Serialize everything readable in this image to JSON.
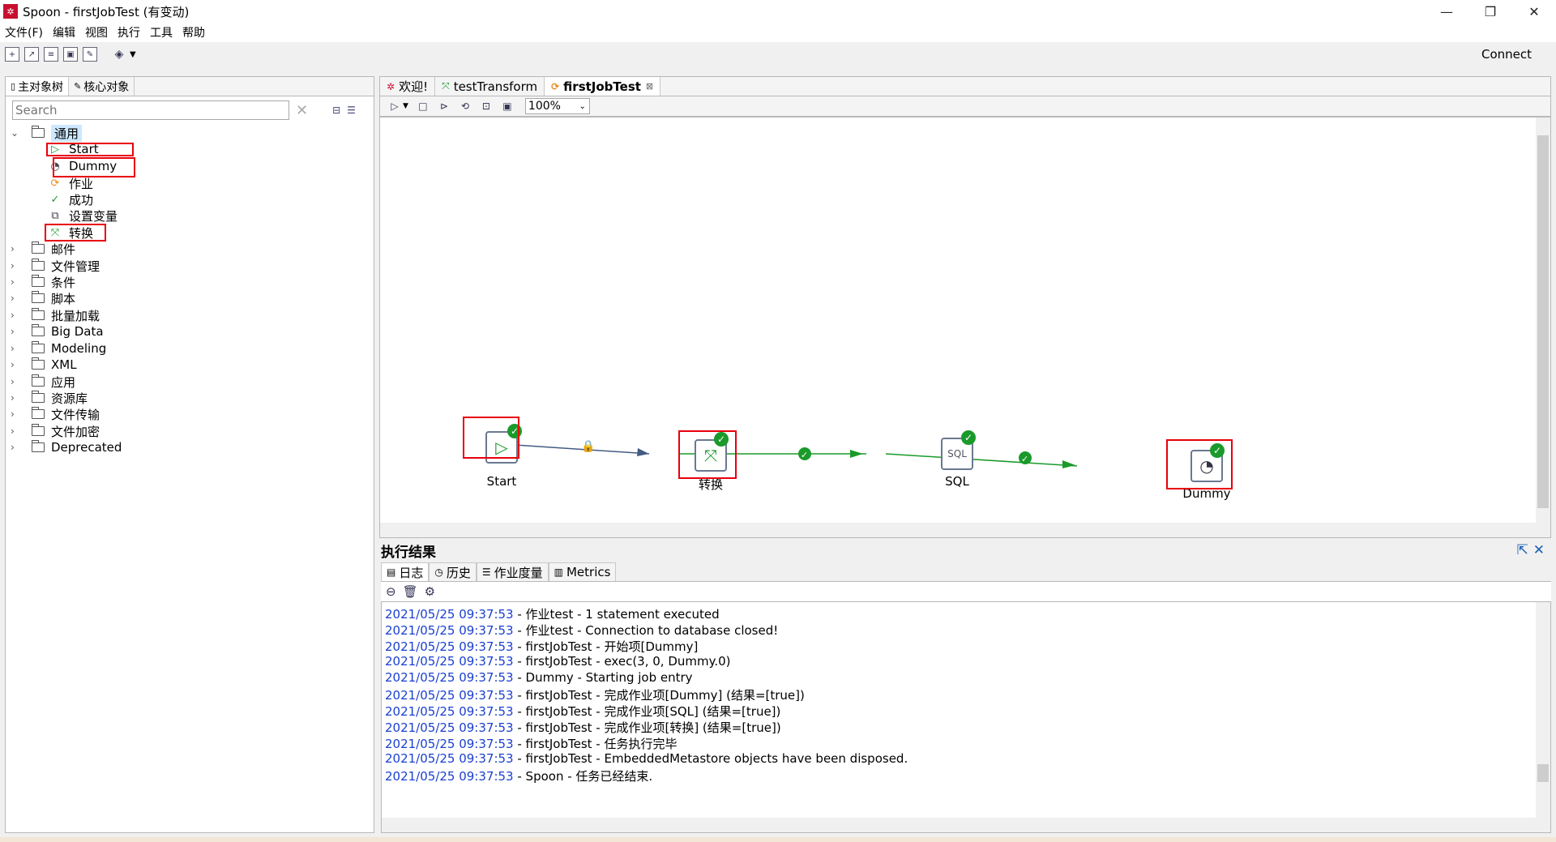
{
  "window": {
    "title": "Spoon - firstJobTest (有变动)",
    "app_icon": "spoon-icon",
    "controls": [
      "minimize",
      "restore",
      "close"
    ]
  },
  "menu": [
    "文件(F)",
    "编辑",
    "视图",
    "执行",
    "工具",
    "帮助"
  ],
  "toolbar": {
    "connect_label": "Connect"
  },
  "left_panel": {
    "tabs": [
      "主对象树",
      "核心对象"
    ],
    "search_placeholder": "Search",
    "tree": [
      {
        "label": "通用",
        "expanded": true,
        "selected": true,
        "children": [
          {
            "label": "Start",
            "icon": "start-icon"
          },
          {
            "label": "Dummy",
            "icon": "dummy-icon"
          },
          {
            "label": "作业",
            "icon": "job-icon"
          },
          {
            "label": "成功",
            "icon": "success-icon"
          },
          {
            "label": "设置变量",
            "icon": "set-variable-icon"
          },
          {
            "label": "转换",
            "icon": "transform-icon"
          }
        ]
      },
      {
        "label": "邮件"
      },
      {
        "label": "文件管理"
      },
      {
        "label": "条件"
      },
      {
        "label": "脚本"
      },
      {
        "label": "批量加载"
      },
      {
        "label": "Big Data"
      },
      {
        "label": "Modeling"
      },
      {
        "label": "XML"
      },
      {
        "label": "应用"
      },
      {
        "label": "资源库"
      },
      {
        "label": "文件传输"
      },
      {
        "label": "文件加密"
      },
      {
        "label": "Deprecated"
      }
    ]
  },
  "editor": {
    "tabs": [
      {
        "label": "欢迎!",
        "active": false
      },
      {
        "label": "testTransform",
        "active": false
      },
      {
        "label": "firstJobTest",
        "active": true
      }
    ],
    "zoom": "100%",
    "nodes": [
      {
        "label": "Start",
        "icon": "start-icon"
      },
      {
        "label": "转换",
        "icon": "transform-icon"
      },
      {
        "label": "SQL",
        "icon": "sql-icon"
      },
      {
        "label": "Dummy",
        "icon": "dummy-icon"
      }
    ]
  },
  "results": {
    "title": "执行结果",
    "tabs": [
      "日志",
      "历史",
      "作业度量",
      "Metrics"
    ],
    "log": [
      {
        "ts": "2021/05/25 09:37:53",
        "msg": " - 作业test - 1 statement executed"
      },
      {
        "ts": "2021/05/25 09:37:53",
        "msg": " - 作业test - Connection to database closed!"
      },
      {
        "ts": "2021/05/25 09:37:53",
        "msg": " - firstJobTest - 开始项[Dummy]"
      },
      {
        "ts": "2021/05/25 09:37:53",
        "msg": " - firstJobTest - exec(3, 0, Dummy.0)"
      },
      {
        "ts": "2021/05/25 09:37:53",
        "msg": " - Dummy - Starting job entry"
      },
      {
        "ts": "2021/05/25 09:37:53",
        "msg": " - firstJobTest - 完成作业项[Dummy] (结果=[true])"
      },
      {
        "ts": "2021/05/25 09:37:53",
        "msg": " - firstJobTest - 完成作业项[SQL] (结果=[true])"
      },
      {
        "ts": "2021/05/25 09:37:53",
        "msg": " - firstJobTest - 完成作业项[转换] (结果=[true])"
      },
      {
        "ts": "2021/05/25 09:37:53",
        "msg": " - firstJobTest - 任务执行完毕"
      },
      {
        "ts": "2021/05/25 09:37:53",
        "msg": " - firstJobTest - EmbeddedMetastore objects have been disposed."
      },
      {
        "ts": "2021/05/25 09:37:53",
        "msg": " - Spoon - 任务已经结束."
      }
    ]
  }
}
